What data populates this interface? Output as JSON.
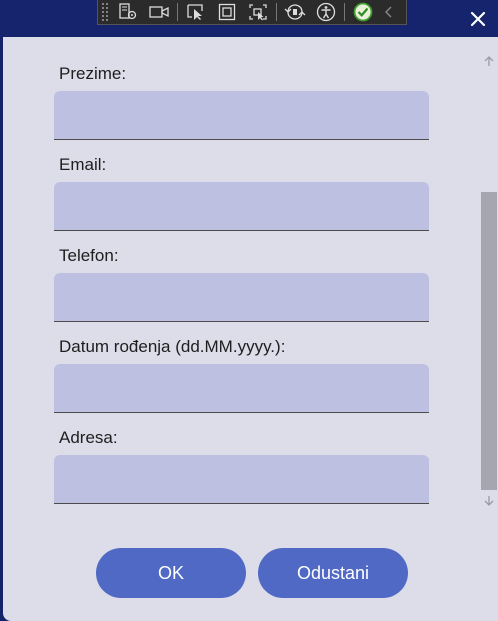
{
  "form": {
    "fields": [
      {
        "label": "Prezime:",
        "value": ""
      },
      {
        "label": "Email:",
        "value": ""
      },
      {
        "label": "Telefon:",
        "value": ""
      },
      {
        "label": "Datum rođenja (dd.MM.yyyy.):",
        "value": ""
      },
      {
        "label": "Adresa:",
        "value": ""
      }
    ],
    "ok_label": "OK",
    "cancel_label": "Odustani"
  },
  "icons": {
    "close": "close-icon",
    "toolbar": [
      "live-visual-tree-icon",
      "record-icon",
      "select-element-icon",
      "display-layout-adorners-icon",
      "track-focus-icon",
      "hot-reload-icon",
      "accessibility-icon",
      "binding-ok-icon",
      "collapse-icon"
    ],
    "scroll_up": "chevron-up-icon",
    "scroll_down": "chevron-down-icon"
  },
  "colors": {
    "titlebar": "#16246d",
    "content_bg": "#dcdde9",
    "input_bg": "#bec0e2",
    "button_bg": "#5069c5",
    "scroll_thumb": "#a6a6b1"
  }
}
